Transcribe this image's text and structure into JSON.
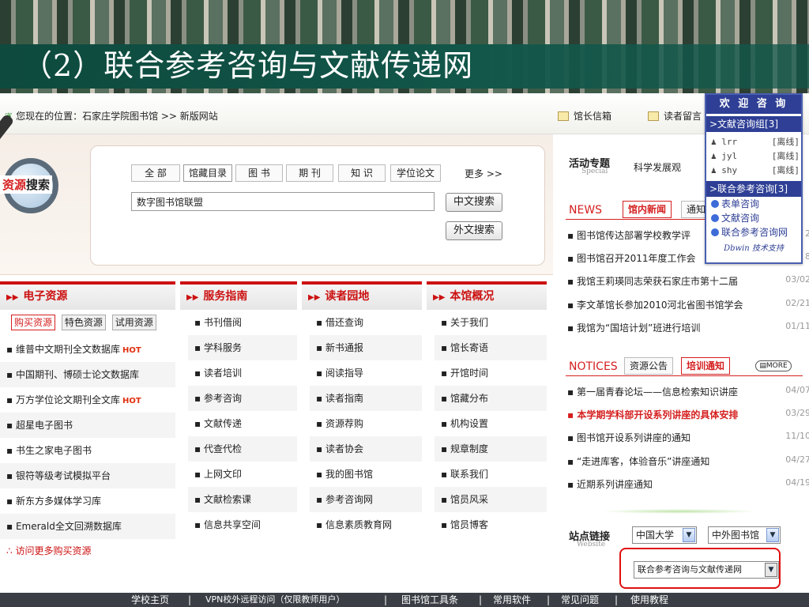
{
  "slide": {
    "title": "（2）联合参考咨询与文献传递网"
  },
  "topbar": {
    "breadcrumb": "您现在的位置：石家庄学院图书馆 >> 新版网站",
    "mailbox": "馆长信箱",
    "guestbook": "读者留言"
  },
  "search": {
    "label_red": "资源",
    "label_black": "搜索",
    "tabs": [
      "全 部",
      "馆藏目录",
      "图 书",
      "期 刊",
      "知 识",
      "学位论文"
    ],
    "more": "更多 >>",
    "input_value": "数字图书馆联盟",
    "btn_cn": "中文搜索",
    "btn_foreign": "外文搜索"
  },
  "columns": {
    "eres": {
      "title": "电子资源",
      "subtabs": [
        "购买资源",
        "特色资源",
        "试用资源"
      ],
      "items": [
        {
          "text": "维普中文期刊全文数据库",
          "hot": "HOT"
        },
        {
          "text": "中国期刊、博硕士论文数据库",
          "hot": ""
        },
        {
          "text": "万方学位论文期刊全文库",
          "hot": "HOT"
        },
        {
          "text": "超星电子图书",
          "hot": ""
        },
        {
          "text": "书生之家电子图书",
          "hot": ""
        },
        {
          "text": "银符等级考试模拟平台",
          "hot": ""
        },
        {
          "text": "新东方多媒体学习库",
          "hot": ""
        },
        {
          "text": "Emerald全文回溯数据库",
          "hot": ""
        }
      ],
      "more": "∴ 访问更多购买资源"
    },
    "service": {
      "title": "服务指南",
      "items": [
        "书刊借阅",
        "学科服务",
        "读者培训",
        "参考咨询",
        "文献传递",
        "代查代检",
        "上网文印",
        "文献检索课",
        "信息共享空间"
      ]
    },
    "reader": {
      "title": "读者园地",
      "items": [
        "借还查询",
        "新书通报",
        "阅读指导",
        "读者指南",
        "资源荐购",
        "读者协会",
        "我的图书馆",
        "参考咨询网",
        "信息素质教育网"
      ]
    },
    "about": {
      "title": "本馆概况",
      "items": [
        "关于我们",
        "馆长寄语",
        "开馆时间",
        "馆藏分布",
        "机构设置",
        "规章制度",
        "联系我们",
        "馆员风采",
        "馆员博客"
      ]
    }
  },
  "right": {
    "activity_title": "活动专题",
    "activity_sub": "Special",
    "activity_text": "科学发展观",
    "news_en": "NEWS",
    "news_tab1": "馆内新闻",
    "news_tab2": "通知",
    "news": [
      {
        "text": "图书馆传达部署学校教学评",
        "date": "2"
      },
      {
        "text": "图书馆召开2011年度工作会",
        "date": "8"
      },
      {
        "text": "我馆王莉瑛同志荣获石家庄市第十二届",
        "date": "03/02"
      },
      {
        "text": "李文革馆长参加2010河北省图书馆学会",
        "date": "02/21"
      },
      {
        "text": "我馆为“国培计划”班进行培训",
        "date": "01/11"
      }
    ],
    "notices_en": "NOTICES",
    "notice_tab1": "资源公告",
    "notice_tab2": "培训通知",
    "notice_more": "MORE",
    "notices": [
      {
        "text": "第一届青春论坛——信息检索知识讲座",
        "date": "04/07"
      },
      {
        "text": "本学期学科部开设系列讲座的具体安排",
        "date": "03/29"
      },
      {
        "text": "图书馆开设系列讲座的通知",
        "date": "11/10"
      },
      {
        "text": "“走进库客，体验音乐”讲座通知",
        "date": "04/27"
      },
      {
        "text": "近期系列讲座通知",
        "date": "04/19"
      }
    ],
    "links_title": "站点链接",
    "links_sub": "Website",
    "select1": "中国大学",
    "select2": "中外图书馆",
    "select3": "联合参考咨询与文献传递网"
  },
  "welcome": {
    "title": "欢 迎 咨 询",
    "group1": ">文献咨询组[3]",
    "users": [
      {
        "name": "lrr",
        "status": "[离线]"
      },
      {
        "name": "jyl",
        "status": "[离线]"
      },
      {
        "name": "shy",
        "status": "[离线]"
      }
    ],
    "group2": ">联合参考咨询[3]",
    "links": [
      "表单咨询",
      "文献咨询",
      "联合参考咨询网"
    ],
    "footer": "Dbwin 技术支持"
  },
  "footer": {
    "items": [
      "学校主页",
      "|",
      "VPN校外远程访问（仅限教师用户）",
      "|",
      "图书馆工具条",
      "|",
      "常用软件",
      "|",
      "常见问题",
      "|",
      "使用教程"
    ]
  }
}
